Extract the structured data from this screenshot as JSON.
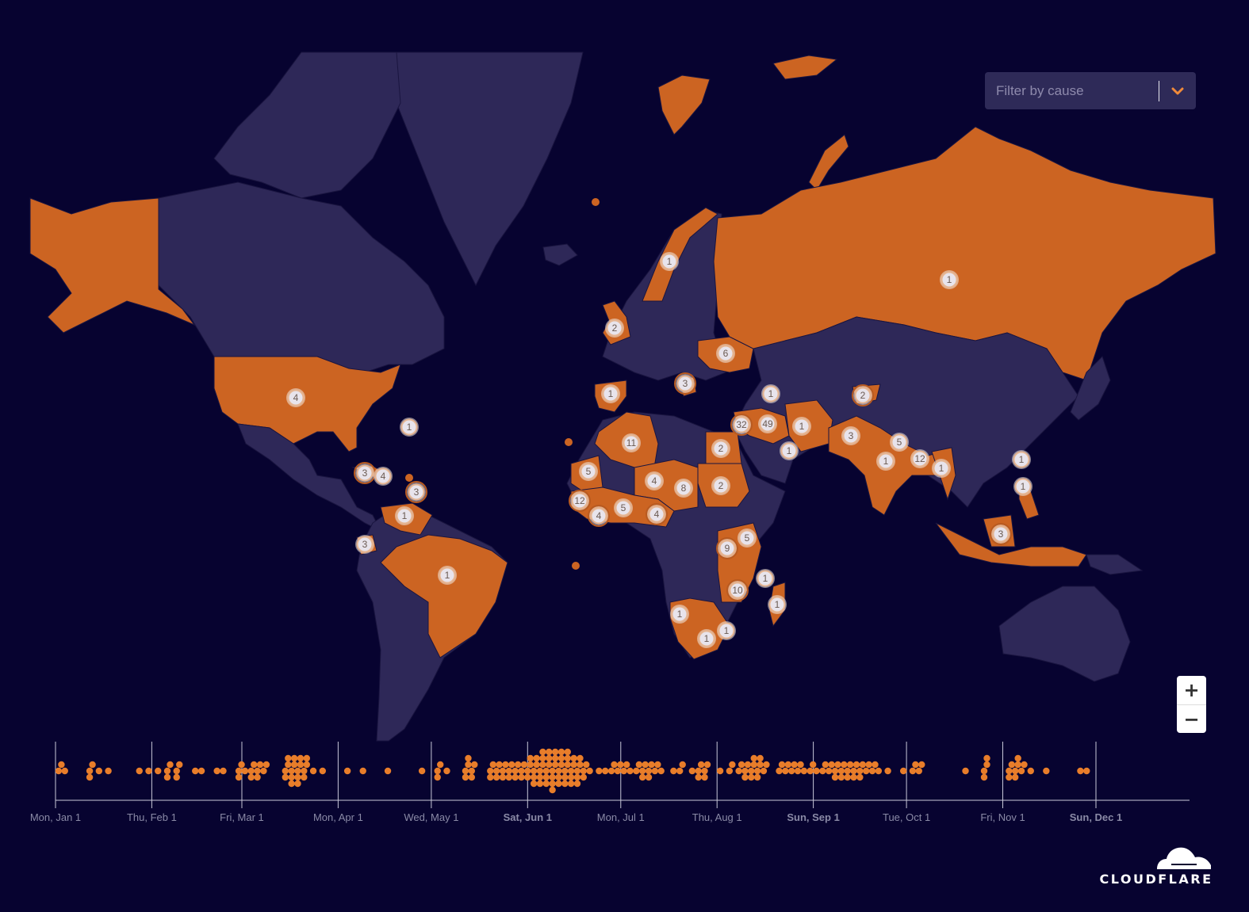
{
  "filter": {
    "placeholder": "Filter by cause",
    "icon": "chevron-down-icon"
  },
  "zoom_control": {
    "zoom_in_label": "+",
    "zoom_out_label": "−"
  },
  "logo": {
    "text": "CLOUDFLARE",
    "icon": "cloud-icon"
  },
  "colors": {
    "background": "#070330",
    "land": "#2e2858",
    "highlight": "#cc6422",
    "dot": "#e87d2a"
  },
  "markers": [
    {
      "region": "United States",
      "count": "4"
    },
    {
      "region": "Bermuda",
      "count": "1"
    },
    {
      "region": "Cuba",
      "count": "3"
    },
    {
      "region": "Haiti",
      "count": "4"
    },
    {
      "region": "Lesser Antilles",
      "count": "3"
    },
    {
      "region": "Venezuela",
      "count": "1"
    },
    {
      "region": "Ecuador",
      "count": "3"
    },
    {
      "region": "Brazil",
      "count": "1"
    },
    {
      "region": "Norway",
      "count": "1"
    },
    {
      "region": "United Kingdom",
      "count": "2"
    },
    {
      "region": "Ukraine",
      "count": "6"
    },
    {
      "region": "Russia",
      "count": "1"
    },
    {
      "region": "Spain",
      "count": "1"
    },
    {
      "region": "Balkans",
      "count": "3"
    },
    {
      "region": "Georgia",
      "count": "1"
    },
    {
      "region": "Syria",
      "count": "32"
    },
    {
      "region": "Iraq",
      "count": "49"
    },
    {
      "region": "Iran",
      "count": "1"
    },
    {
      "region": "UAE",
      "count": "1"
    },
    {
      "region": "Algeria",
      "count": "11"
    },
    {
      "region": "Egypt",
      "count": "2"
    },
    {
      "region": "Mauritania",
      "count": "5"
    },
    {
      "region": "Niger",
      "count": "4"
    },
    {
      "region": "Chad",
      "count": "8"
    },
    {
      "region": "Sudan",
      "count": "2"
    },
    {
      "region": "Guinea",
      "count": "12"
    },
    {
      "region": "Liberia",
      "count": "4"
    },
    {
      "region": "Ghana",
      "count": "5"
    },
    {
      "region": "Nigeria",
      "count": "4"
    },
    {
      "region": "Kyrgyzstan",
      "count": "2"
    },
    {
      "region": "Pakistan",
      "count": "3"
    },
    {
      "region": "Nepal",
      "count": "5"
    },
    {
      "region": "India",
      "count": "1"
    },
    {
      "region": "Bangladesh",
      "count": "12"
    },
    {
      "region": "Myanmar",
      "count": "1"
    },
    {
      "region": "Taiwan",
      "count": "1"
    },
    {
      "region": "Philippines",
      "count": "1"
    },
    {
      "region": "Indonesia",
      "count": "3"
    },
    {
      "region": "Kenya",
      "count": "5"
    },
    {
      "region": "Tanzania",
      "count": "9"
    },
    {
      "region": "Comoros",
      "count": "1"
    },
    {
      "region": "Mozambique",
      "count": "10"
    },
    {
      "region": "Madagascar",
      "count": "1"
    },
    {
      "region": "Namibia",
      "count": "1"
    },
    {
      "region": "South Africa",
      "count": "1"
    },
    {
      "region": "Eswatini",
      "count": "1"
    }
  ],
  "chart_data": {
    "type": "scatter",
    "title": "",
    "xlabel": "",
    "ylabel": "",
    "x_range": [
      "2024-01-01",
      "2024-12-31"
    ],
    "tick_labels": [
      {
        "label": "Mon, Jan 1",
        "date": "2024-01-01",
        "bold": false
      },
      {
        "label": "Thu, Feb 1",
        "date": "2024-02-01",
        "bold": false
      },
      {
        "label": "Fri, Mar 1",
        "date": "2024-03-01",
        "bold": false
      },
      {
        "label": "Mon, Apr 1",
        "date": "2024-04-01",
        "bold": false
      },
      {
        "label": "Wed, May 1",
        "date": "2024-05-01",
        "bold": false
      },
      {
        "label": "Sat, Jun 1",
        "date": "2024-06-01",
        "bold": true
      },
      {
        "label": "Mon, Jul 1",
        "date": "2024-07-01",
        "bold": false
      },
      {
        "label": "Thu, Aug 1",
        "date": "2024-08-01",
        "bold": false
      },
      {
        "label": "Sun, Sep 1",
        "date": "2024-09-01",
        "bold": true
      },
      {
        "label": "Tue, Oct 1",
        "date": "2024-10-01",
        "bold": false
      },
      {
        "label": "Fri, Nov 1",
        "date": "2024-11-01",
        "bold": false
      },
      {
        "label": "Sun, Dec 1",
        "date": "2024-12-01",
        "bold": true
      }
    ],
    "events_per_day": [
      [
        1,
        2
      ],
      [
        3,
        1
      ],
      [
        11,
        3
      ],
      [
        14,
        1
      ],
      [
        17,
        1
      ],
      [
        27,
        1
      ],
      [
        30,
        1
      ],
      [
        33,
        1
      ],
      [
        36,
        3
      ],
      [
        39,
        3
      ],
      [
        45,
        1
      ],
      [
        47,
        1
      ],
      [
        52,
        1
      ],
      [
        54,
        1
      ],
      [
        59,
        3
      ],
      [
        61,
        1
      ],
      [
        63,
        3
      ],
      [
        65,
        3
      ],
      [
        67,
        2
      ],
      [
        74,
        4
      ],
      [
        76,
        5
      ],
      [
        78,
        5
      ],
      [
        80,
        4
      ],
      [
        83,
        1
      ],
      [
        86,
        1
      ],
      [
        94,
        1
      ],
      [
        99,
        1
      ],
      [
        107,
        1
      ],
      [
        118,
        1
      ],
      [
        123,
        3
      ],
      [
        126,
        1
      ],
      [
        132,
        4
      ],
      [
        134,
        3
      ],
      [
        140,
        3
      ],
      [
        142,
        3
      ],
      [
        144,
        3
      ],
      [
        146,
        3
      ],
      [
        148,
        3
      ],
      [
        150,
        3
      ],
      [
        152,
        4
      ],
      [
        154,
        5
      ],
      [
        156,
        6
      ],
      [
        158,
        6
      ],
      [
        160,
        7
      ],
      [
        162,
        6
      ],
      [
        164,
        6
      ],
      [
        166,
        5
      ],
      [
        168,
        5
      ],
      [
        170,
        3
      ],
      [
        172,
        1
      ],
      [
        175,
        1
      ],
      [
        177,
        1
      ],
      [
        179,
        2
      ],
      [
        181,
        2
      ],
      [
        183,
        2
      ],
      [
        185,
        1
      ],
      [
        187,
        2
      ],
      [
        189,
        3
      ],
      [
        191,
        3
      ],
      [
        193,
        2
      ],
      [
        195,
        1
      ],
      [
        199,
        1
      ],
      [
        201,
        2
      ],
      [
        205,
        1
      ],
      [
        207,
        3
      ],
      [
        209,
        3
      ],
      [
        214,
        1
      ],
      [
        217,
        2
      ],
      [
        220,
        2
      ],
      [
        222,
        3
      ],
      [
        224,
        4
      ],
      [
        226,
        4
      ],
      [
        228,
        2
      ],
      [
        233,
        2
      ],
      [
        235,
        2
      ],
      [
        237,
        2
      ],
      [
        239,
        2
      ],
      [
        241,
        1
      ],
      [
        243,
        2
      ],
      [
        245,
        1
      ],
      [
        247,
        2
      ],
      [
        249,
        2
      ],
      [
        251,
        3
      ],
      [
        253,
        3
      ],
      [
        255,
        3
      ],
      [
        257,
        3
      ],
      [
        259,
        3
      ],
      [
        261,
        2
      ],
      [
        263,
        2
      ],
      [
        265,
        1
      ],
      [
        268,
        1
      ],
      [
        273,
        1
      ],
      [
        276,
        2
      ],
      [
        278,
        2
      ],
      [
        293,
        1
      ],
      [
        299,
        4
      ],
      [
        307,
        3
      ],
      [
        309,
        4
      ],
      [
        311,
        2
      ],
      [
        314,
        1
      ],
      [
        319,
        1
      ],
      [
        330,
        1
      ],
      [
        332,
        1
      ]
    ]
  }
}
